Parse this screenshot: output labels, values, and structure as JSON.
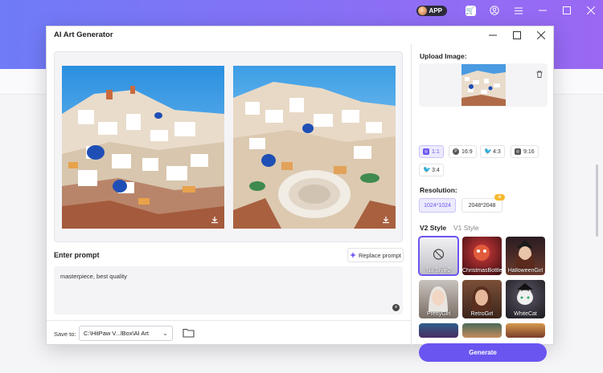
{
  "app": {
    "app_badge": "APP",
    "topbar_icons": [
      "cart-icon",
      "account-icon",
      "menu-icon",
      "minimize-icon",
      "maximize-icon",
      "close-icon"
    ]
  },
  "dialog": {
    "title": "AI Art Generator",
    "window_controls": [
      "minimize-icon",
      "maximize-icon",
      "close-icon"
    ]
  },
  "left": {
    "prompt_label": "Enter prompt",
    "replace_prompt": "Replace prompt",
    "prompt_text": "masterpiece, best quality",
    "save_to_label": "Save to:",
    "save_path": "C:\\HitPaw V...lBox\\AI Art"
  },
  "right": {
    "upload_label": "Upload Image:",
    "aspect_ratios": [
      {
        "label": "1:1",
        "icon": "instagram-icon",
        "active": true
      },
      {
        "label": "16:9",
        "icon": "pinterest-icon",
        "active": false
      },
      {
        "label": "4:3",
        "icon": "twitter-icon",
        "active": false
      },
      {
        "label": "9:16",
        "icon": "instagram-icon",
        "active": false
      },
      {
        "label": "3:4",
        "icon": "twitter-icon",
        "active": false
      }
    ],
    "resolution_label": "Resolution:",
    "resolutions": [
      {
        "label": "1024*1024",
        "active": true
      },
      {
        "label": "2048*2048",
        "active": false,
        "premium": true
      }
    ],
    "style_tabs": {
      "v2": "V2 Style",
      "v1": "V1 Style"
    },
    "styles": [
      {
        "label": "No Style2",
        "selected": true
      },
      {
        "label": "ChristmasBottle",
        "selected": false
      },
      {
        "label": "HalloweenGirl",
        "selected": false
      },
      {
        "label": "PrettyGirl",
        "selected": false
      },
      {
        "label": "RetroGirl",
        "selected": false
      },
      {
        "label": "WhiteCat",
        "selected": false
      }
    ],
    "generate": "Generate"
  },
  "colors": {
    "accent": "#6a55f0",
    "header_gradient_start": "#6f7bf7",
    "header_gradient_end": "#9a68f3"
  }
}
